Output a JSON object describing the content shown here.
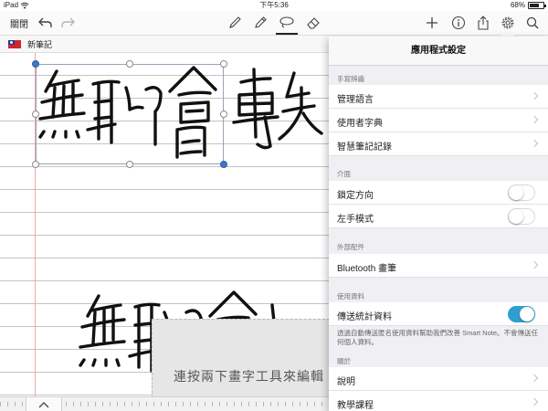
{
  "status_bar": {
    "device": "iPad",
    "wifi_icon": "wifi-icon",
    "time": "下午5:36",
    "battery": "68%",
    "battery_level": 0.68
  },
  "toolbar": {
    "close_label": "關閉",
    "icons": [
      "undo-icon",
      "redo-icon",
      "pen-icon",
      "pencil-icon",
      "lasso-icon",
      "eraser-icon",
      "plus-icon",
      "info-icon",
      "share-icon",
      "gear-icon",
      "search-icon"
    ],
    "active_tool": "lasso-icon"
  },
  "note": {
    "title": "新筆記",
    "flag_icon": "taiwan-flag-icon"
  },
  "canvas": {
    "hint_text": "連按兩下畫字工具來編輯"
  },
  "settings": {
    "title": "應用程式設定",
    "sections": [
      {
        "header": "手寫辨識",
        "rows": [
          {
            "label": "管理語言",
            "type": "link"
          },
          {
            "label": "使用者字典",
            "type": "link"
          },
          {
            "label": "智慧筆記記錄",
            "type": "link"
          }
        ]
      },
      {
        "header": "介面",
        "rows": [
          {
            "label": "鎖定方向",
            "type": "toggle",
            "value": false
          },
          {
            "label": "左手模式",
            "type": "toggle",
            "value": false
          }
        ]
      },
      {
        "header": "外部配件",
        "rows": [
          {
            "label": "Bluetooth 畫筆",
            "type": "link"
          }
        ]
      },
      {
        "header": "使用資料",
        "rows": [
          {
            "label": "傳送統計資料",
            "type": "toggle",
            "value": true
          }
        ]
      },
      {
        "header": "關於",
        "rows": [
          {
            "label": "說明",
            "type": "link"
          },
          {
            "label": "教學課程",
            "type": "link"
          }
        ]
      }
    ],
    "usage_footnote": "透過自動傳送匿名使用資料幫助我們改善 Smart Note。不會傳送任何個人資料。"
  },
  "colors": {
    "toggle_on": "#2f9fd0",
    "selection_handle": "#3e78c8",
    "margin_line": "#f0a6a6",
    "ink": "#111111"
  }
}
